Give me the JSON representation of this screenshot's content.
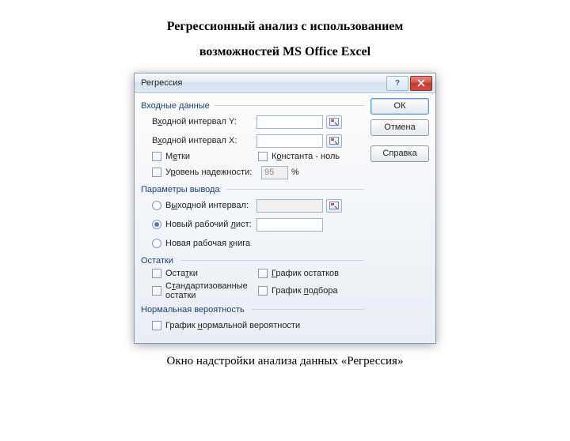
{
  "page": {
    "title_line1": "Регрессионный анализ с использованием",
    "title_line2": "возможностей MS Office Excel",
    "caption": "Окно надстройки анализа данных «Регрессия»"
  },
  "dialog": {
    "title": "Регрессия",
    "help_symbol": "?",
    "buttons": {
      "ok": "ОК",
      "cancel": "Отмена",
      "help": "Справка"
    },
    "groups": {
      "input": {
        "header": "Входные данные",
        "y_label_pre": "В",
        "y_label_hot": "х",
        "y_label_post": "одной интервал Y:",
        "x_label_pre": "В",
        "x_label_hot": "х",
        "x_label_post": "одной интервал X:",
        "y_value": "",
        "x_value": "",
        "labels_chk_pre": "М",
        "labels_chk_hot": "е",
        "labels_chk_post": "тки",
        "const_chk_pre": "К",
        "const_chk_hot": "о",
        "const_chk_post": "нстанта - ноль",
        "conf_chk_pre": "У",
        "conf_chk_hot": "р",
        "conf_chk_post": "овень надежности:",
        "conf_value": "95",
        "conf_pct": "%"
      },
      "output": {
        "header": "Параметры вывода",
        "range_radio_pre": "В",
        "range_radio_hot": "ы",
        "range_radio_post": "ходной интервал:",
        "range_value": "",
        "sheet_radio_pre": "Новый рабочий ",
        "sheet_radio_hot": "л",
        "sheet_radio_post": "ист:",
        "sheet_value": "",
        "book_radio_pre": "Новая рабочая ",
        "book_radio_hot": "к",
        "book_radio_post": "нига",
        "selected": "sheet"
      },
      "residuals": {
        "header": "Остатки",
        "resid_chk_pre": "Оста",
        "resid_chk_hot": "т",
        "resid_chk_post": "ки",
        "stdresid_chk_pre": "С",
        "stdresid_chk_hot": "т",
        "stdresid_chk_post": "андартизованные остатки",
        "residplot_chk_pre": "",
        "residplot_chk_hot": "Г",
        "residplot_chk_post": "рафик остатков",
        "fitplot_chk_pre": "График ",
        "fitplot_chk_hot": "п",
        "fitplot_chk_post": "одбора"
      },
      "normal": {
        "header": "Нормальная вероятность",
        "nplot_chk_pre": "График ",
        "nplot_chk_hot": "н",
        "nplot_chk_post": "ормальной вероятности"
      }
    }
  }
}
